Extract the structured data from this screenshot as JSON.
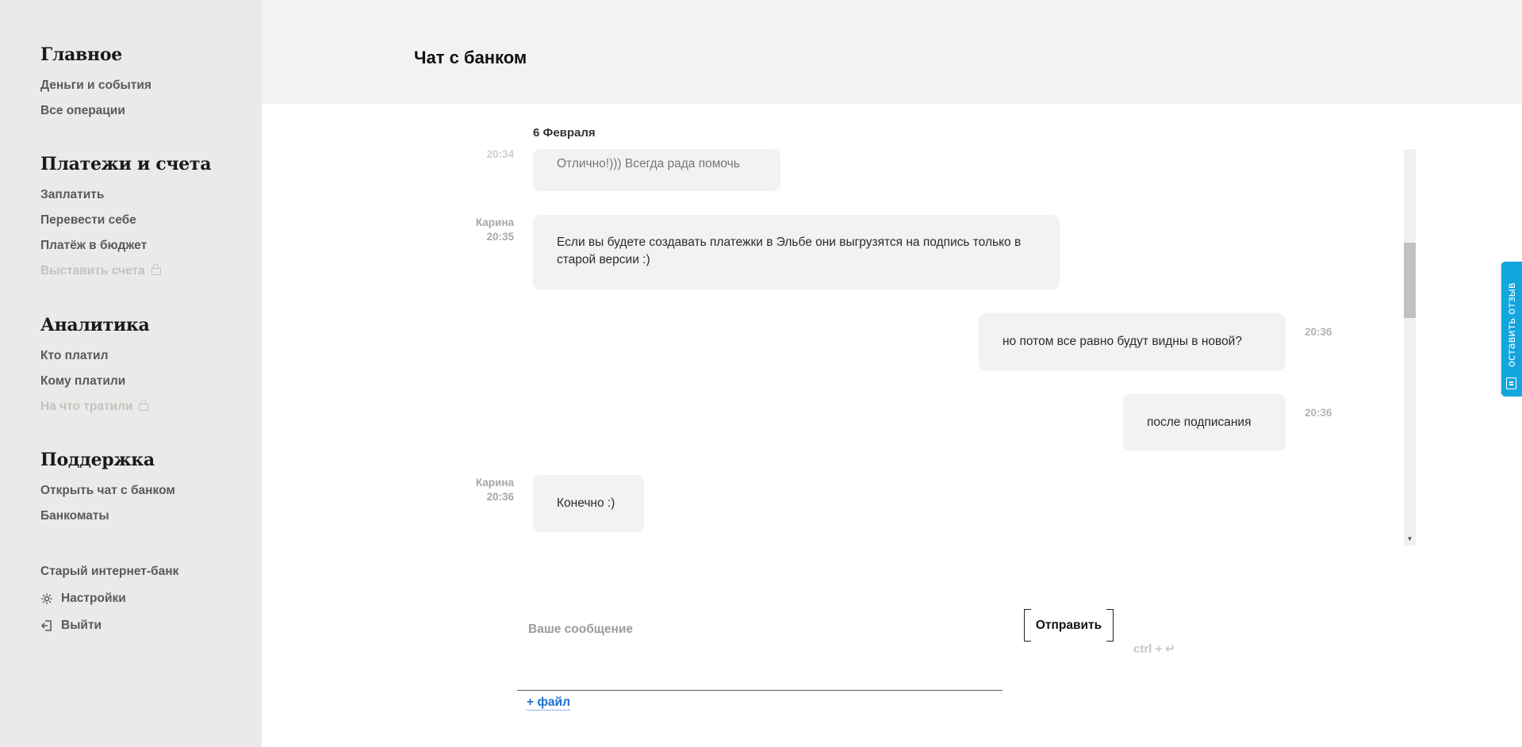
{
  "sidebar": {
    "sections": [
      {
        "heading": "Главное",
        "items": [
          {
            "label": "Деньги и события"
          },
          {
            "label": "Все операции"
          }
        ]
      },
      {
        "heading": "Платежи и счета",
        "items": [
          {
            "label": "Заплатить"
          },
          {
            "label": "Перевести себе"
          },
          {
            "label": "Платёж в бюджет"
          },
          {
            "label": "Выставить счета",
            "locked": true
          }
        ]
      },
      {
        "heading": "Аналитика",
        "items": [
          {
            "label": "Кто платил"
          },
          {
            "label": "Кому платили"
          },
          {
            "label": "На что тратили",
            "locked": true
          }
        ]
      },
      {
        "heading": "Поддержка",
        "items": [
          {
            "label": "Открыть чат с банком"
          },
          {
            "label": "Банкоматы"
          }
        ]
      }
    ],
    "footer": {
      "old_bank": "Старый интернет-банк",
      "settings": "Настройки",
      "settings_icon": "gear-icon",
      "logout": "Выйти",
      "logout_icon": "logout-icon"
    }
  },
  "header": {
    "title": "Чат с банком"
  },
  "chat": {
    "date": "6 Февраля",
    "messages": [
      {
        "side": "left",
        "author": "",
        "time": "20:34",
        "text": "Отлично!))) Всегда рада помочь"
      },
      {
        "side": "left",
        "author": "Карина",
        "time": "20:35",
        "text": "Если вы будете создавать платежки в Эльбе они выгрузятся на подпись только в старой версии :)"
      },
      {
        "side": "right",
        "time": "20:36",
        "text": "но потом все равно будут видны в новой?"
      },
      {
        "side": "right",
        "time": "20:36",
        "text": "после подписания"
      },
      {
        "side": "left",
        "author": "Карина",
        "time": "20:36",
        "text": "Конечно :)"
      }
    ]
  },
  "composer": {
    "placeholder": "Ваше сообщение",
    "send_label": "Отправить",
    "hotkey": "ctrl + ↵",
    "attach_label": "+ файл"
  },
  "feedback": {
    "label": "оставить отзыв",
    "color": "#12a5de"
  },
  "colors": {
    "sidebar_bg": "#ebeae8",
    "header_bg": "#f4f2f1",
    "bubble_bg": "#f2f2f2",
    "link": "#1e6fcf"
  }
}
